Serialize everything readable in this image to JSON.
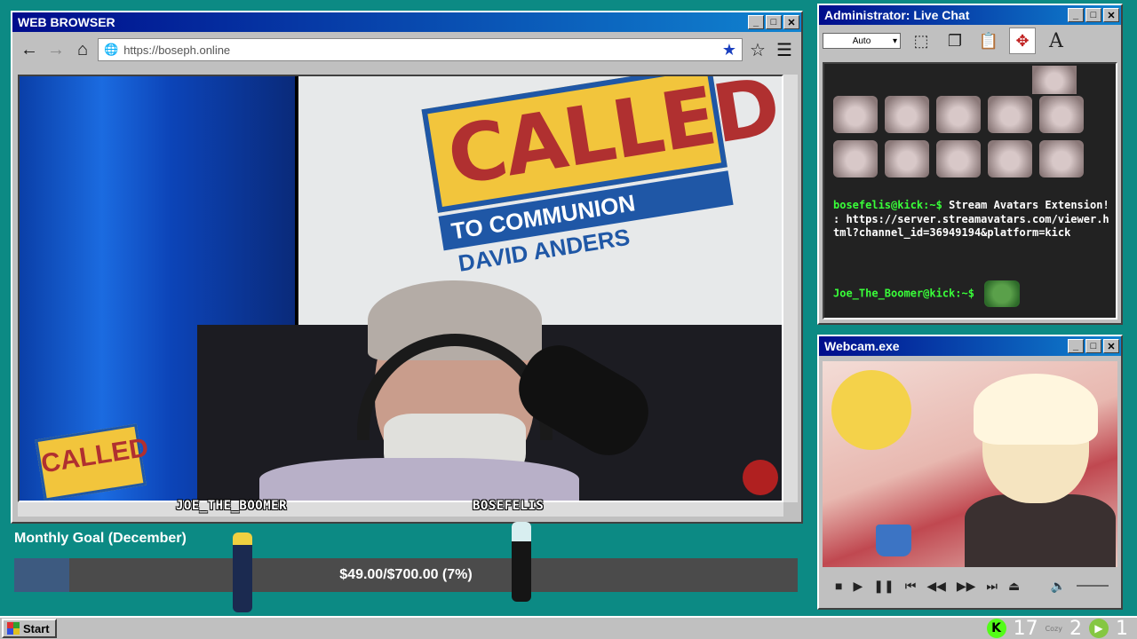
{
  "browser": {
    "title": "WEB BROWSER",
    "url": "https://boseph.online",
    "buttons": {
      "minimize": "_",
      "maximize": "□",
      "close": "✕"
    },
    "stream": {
      "logo_big": {
        "word": "CALLED",
        "band": "TO COMMUNION",
        "sub": "DAVID ANDERS"
      },
      "logo_small": "CALLED",
      "usernames": [
        "JOE_THE_BOOMER",
        "BOSEFELIS"
      ]
    }
  },
  "chat": {
    "title": "Administrator: Live Chat",
    "dropdown": "Auto",
    "messages": [
      {
        "user": "bosefelis@kick:~$",
        "text": "Stream Avatars Extension! : https://server.streamavatars.com/viewer.html?channel_id=36949194&platform=kick"
      },
      {
        "user": "Joe_The_Boomer@kick:~$",
        "text": ""
      }
    ]
  },
  "webcam": {
    "title": "Webcam.exe"
  },
  "goal": {
    "title": "Monthly Goal (December)",
    "text": "$49.00/$700.00 (7%)",
    "progress": 0.07
  },
  "taskbar": {
    "start": "Start",
    "kick_count": "17",
    "cozy_label": "Cozy",
    "cozy_count": "2",
    "rumble_count": "1"
  },
  "colors": {
    "desktop": "#0c8a84",
    "titlebar": "#000c8c",
    "accent": "#1a3fbf"
  }
}
